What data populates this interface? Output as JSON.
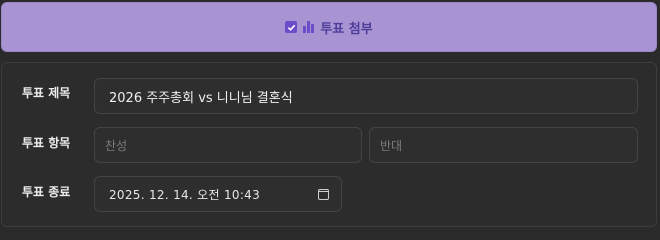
{
  "attach_button": {
    "label": "투표 첨부",
    "checked": true,
    "accent_color": "#6c4dc9",
    "background_color": "#a893d3"
  },
  "vote_form": {
    "title": {
      "label": "투표 제목",
      "value": "2026 주주총회 vs 니니님 결혼식"
    },
    "options": {
      "label": "투표 항목",
      "items": [
        {
          "placeholder": "찬성",
          "value": ""
        },
        {
          "placeholder": "반대",
          "value": ""
        }
      ]
    },
    "end": {
      "label": "투표 종료",
      "value": "2025. 12. 14. 오전 10:43"
    }
  }
}
